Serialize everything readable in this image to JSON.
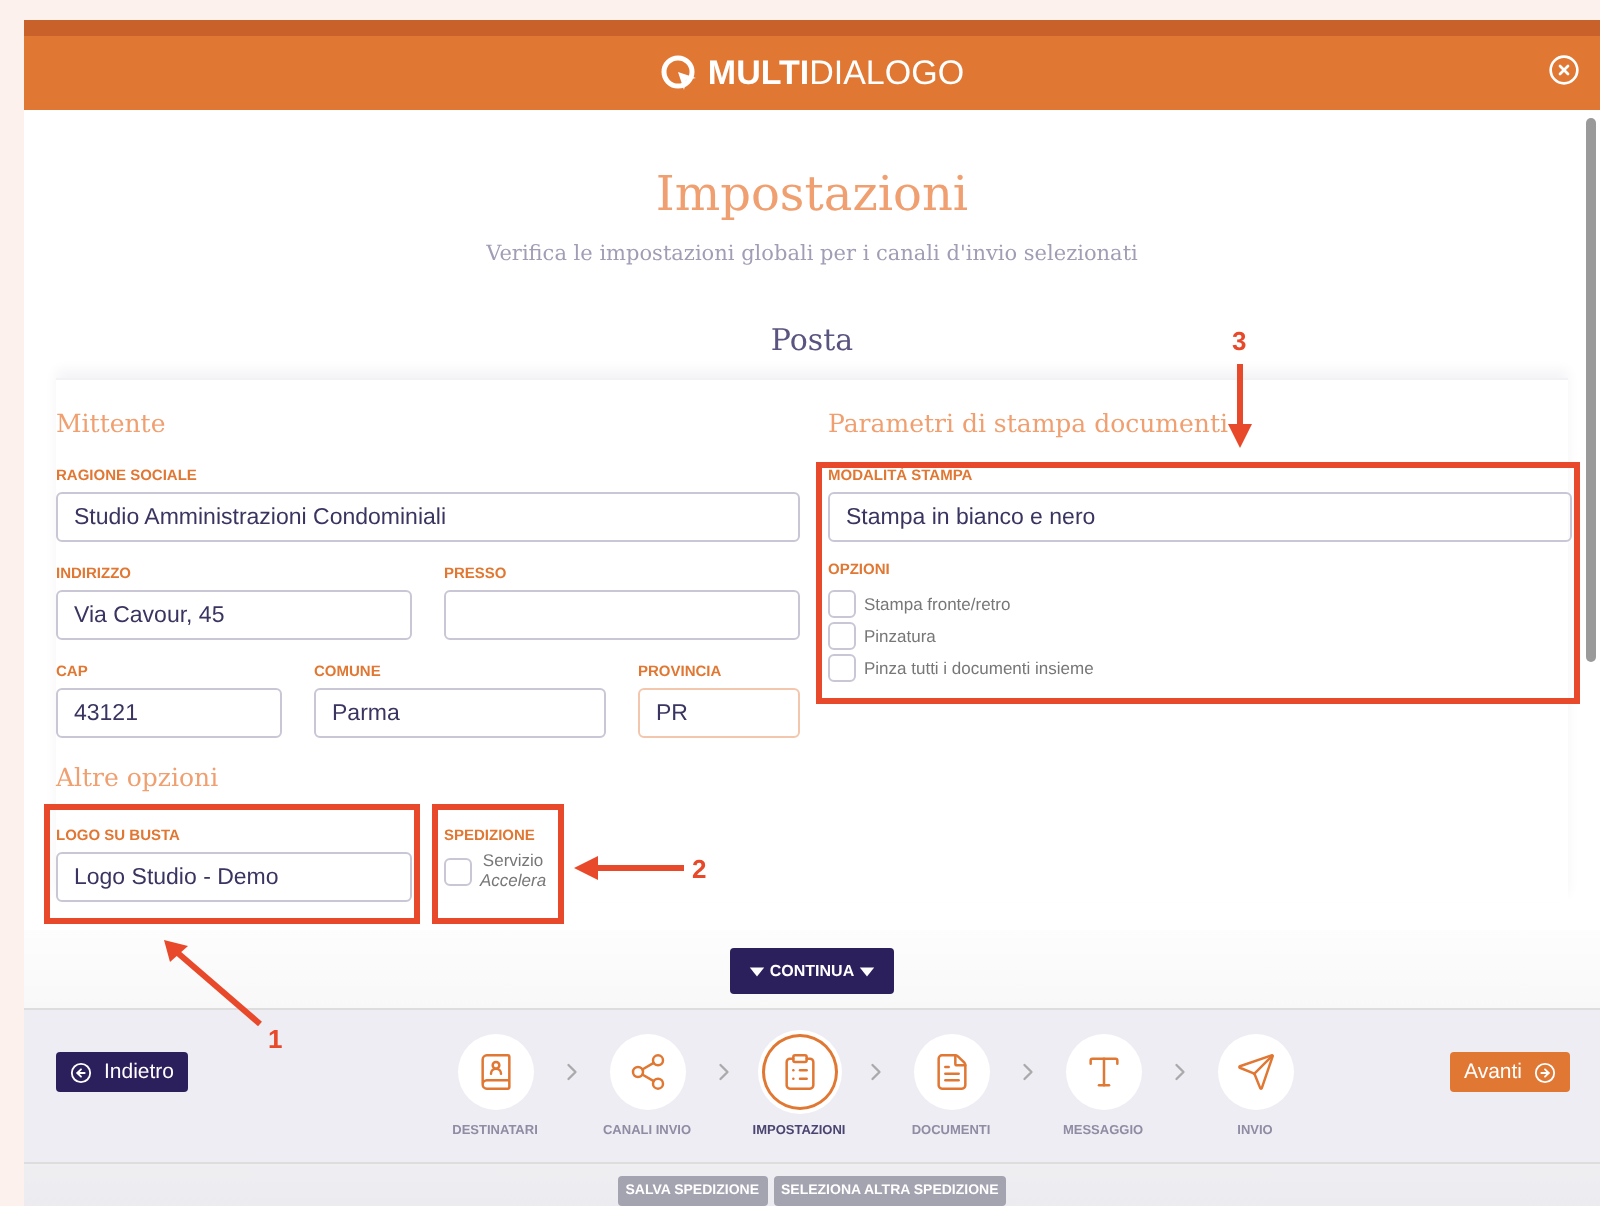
{
  "header": {
    "logo_bold": "MULTI",
    "logo_light": "DIALOGO"
  },
  "title": "Impostazioni",
  "subtitle": "Verifica le impostazioni globali per i canali d'invio selezionati",
  "channel": "Posta",
  "sender": {
    "heading": "Mittente",
    "fields": [
      {
        "label": "RAGIONE SOCIALE",
        "value": "Studio Amministrazioni Condominiali"
      },
      {
        "label": "INDIRIZZO",
        "value": "Via Cavour, 45"
      },
      {
        "label": "PRESSO"
      },
      {
        "label": "CAP",
        "value": "43121"
      },
      {
        "label": "COMUNE",
        "value": "Parma"
      },
      {
        "label": "PROVINCIA",
        "value": "PR"
      }
    ]
  },
  "other_options": {
    "heading": "Altre opzioni",
    "logo_label": "LOGO SU BUSTA",
    "logo_value": "Logo Studio - Demo",
    "shipping_label": "SPEDIZIONE",
    "shipping_option": {
      "label": "Servizio",
      "emphasis": "Accelera",
      "checked": false
    }
  },
  "print": {
    "heading": "Parametri di stampa documenti",
    "mode_label": "MODALITÀ STAMPA",
    "mode_value": "Stampa in bianco e nero",
    "options_label": "OPZIONI",
    "options": [
      {
        "label": "Stampa fronte/retro",
        "checked": false
      },
      {
        "label": "Pinzatura",
        "checked": false
      },
      {
        "label": "Pinza tutti i documenti insieme",
        "checked": false
      }
    ]
  },
  "continue_button": "CONTINUA",
  "back_button": "Indietro",
  "next_button": "Avanti",
  "steps": [
    {
      "label": "DESTINATARI",
      "selected": false
    },
    {
      "label": "CANALI INVIO",
      "selected": false
    },
    {
      "label": "IMPOSTAZIONI",
      "selected": true
    },
    {
      "label": "DOCUMENTI",
      "selected": false
    },
    {
      "label": "MESSAGGIO",
      "selected": false
    },
    {
      "label": "INVIO",
      "selected": false
    }
  ],
  "footer_buttons": [
    "SALVA SPEDIZIONE",
    "SELEZIONA ALTRA SPEDIZIONE"
  ],
  "annotations": [
    {
      "label": "1"
    },
    {
      "label": "2"
    },
    {
      "label": "3"
    }
  ]
}
